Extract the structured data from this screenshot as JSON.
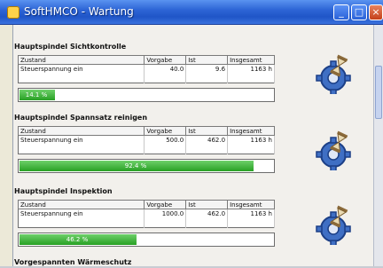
{
  "window": {
    "title": "SoftHMCO - Wartung"
  },
  "columns": {
    "state": "Zustand",
    "target": "Vorgabe",
    "actual": "Ist",
    "total": "Insgesamt"
  },
  "sections": [
    {
      "title": "Hauptspindel Sichtkontrolle",
      "row": {
        "state": "Steuerspannung ein",
        "target": "40.0",
        "actual": "9.6",
        "total": "1163 h"
      },
      "progress_label": "14.1 %",
      "progress_value": 0.141
    },
    {
      "title": "Hauptspindel Spannsatz reinigen",
      "row": {
        "state": "Steuerspannung ein",
        "target": "500.0",
        "actual": "462.0",
        "total": "1163 h"
      },
      "progress_label": "92.4 %",
      "progress_value": 0.924
    },
    {
      "title": "Hauptspindel Inspektion",
      "row": {
        "state": "Steuerspannung ein",
        "target": "1000.0",
        "actual": "462.0",
        "total": "1163 h"
      },
      "progress_label": "46.2 %",
      "progress_value": 0.462
    },
    {
      "title": "Vorgespannten Wärmeschutz",
      "row": null,
      "progress_label": "",
      "progress_value": null
    }
  ],
  "icons": {
    "maintenance": "gear-hourglass-icon"
  },
  "colors": {
    "progress": "#34b030",
    "titlebar": "#2e66d6"
  }
}
